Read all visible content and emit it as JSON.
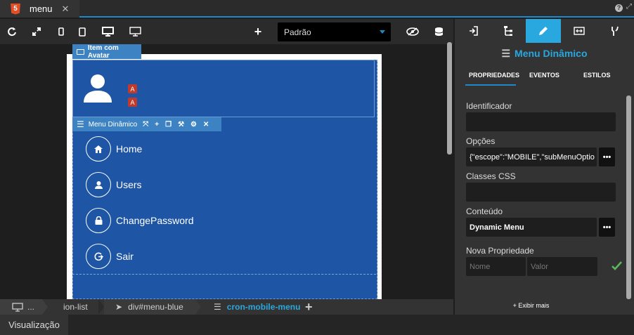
{
  "tab": {
    "title": "menu",
    "html5": "5",
    "close": "✕"
  },
  "window": {
    "help": "?",
    "expand": "⤢"
  },
  "toolbar": {
    "icons": [
      "refresh-icon",
      "fullscreen-icon",
      "phone-small-icon",
      "phone-icon",
      "desktop-icon",
      "monitor-icon",
      "add-icon"
    ],
    "device_select": "Padrão"
  },
  "canvas": {
    "avatar_label": "Item com Avatar",
    "menu_label": "Menu Dinâmico",
    "menu_items": [
      {
        "label": "Home",
        "icon": "home-icon"
      },
      {
        "label": "Users",
        "icon": "user-icon"
      },
      {
        "label": "ChangePassword",
        "icon": "lock-icon"
      },
      {
        "label": "Sair",
        "icon": "logout-icon"
      }
    ],
    "avatar_badges": [
      "A",
      "A"
    ]
  },
  "breadcrumb": [
    "...",
    "ion-list",
    "div#menu-blue",
    "cron-mobile-menu"
  ],
  "bottom": {
    "view_label": "Visualização"
  },
  "panel": {
    "title": "Menu Dinâmico",
    "subtabs": [
      "PROPRIEDADES",
      "EVENTOS",
      "ESTILOS"
    ],
    "fields": [
      {
        "label": "Identificador",
        "value": ""
      },
      {
        "label": "Opções",
        "value": "{\"escope\":\"MOBILE\",\"subMenuOptio"
      },
      {
        "label": "Classes CSS",
        "value": ""
      },
      {
        "label": "Conteúdo",
        "value": "Dynamic Menu"
      }
    ],
    "new_prop_label": "Nova Propriedade",
    "name_placeholder": "Nome",
    "value_placeholder": "Valor",
    "show_more": "+ Exibir mais",
    "dots": "•••"
  },
  "colors": {
    "accent": "#1e88c8",
    "menu_bg": "#1e55a5",
    "title": "#29a8e0"
  }
}
